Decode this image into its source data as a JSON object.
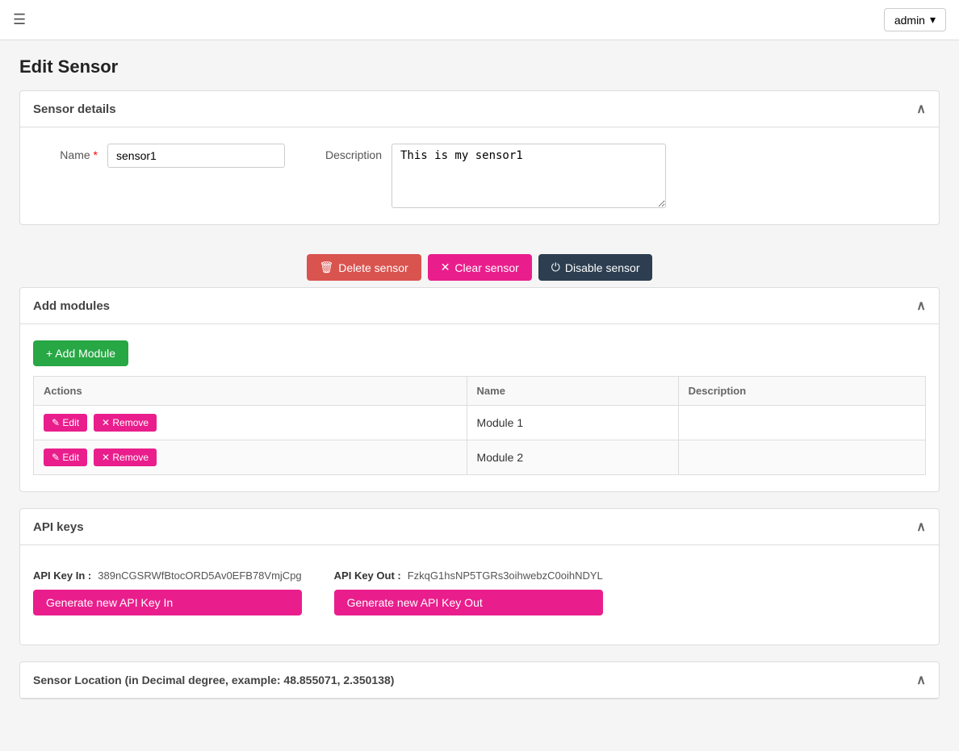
{
  "nav": {
    "hamburger": "☰",
    "admin_label": "admin",
    "admin_dropdown_arrow": "▾"
  },
  "page": {
    "title": "Edit Sensor"
  },
  "sensor_details": {
    "section_title": "Sensor details",
    "name_label": "Name",
    "name_required": "*",
    "name_value": "sensor1",
    "description_label": "Description",
    "description_value": "This is my sensor1"
  },
  "action_buttons": {
    "delete_label": "Delete sensor",
    "clear_label": "Clear sensor",
    "disable_label": "Disable sensor",
    "delete_icon": "🗑",
    "clear_icon": "✕",
    "disable_icon": "⏻"
  },
  "add_modules": {
    "section_title": "Add modules",
    "add_button_label": "+ Add Module",
    "table": {
      "headers": [
        "Actions",
        "Name",
        "Description"
      ],
      "rows": [
        {
          "name": "Module 1",
          "description": ""
        },
        {
          "name": "Module 2",
          "description": ""
        }
      ]
    },
    "edit_label": "Edit",
    "remove_label": "Remove",
    "edit_icon": "✎",
    "remove_icon": "✕"
  },
  "api_keys": {
    "section_title": "API keys",
    "api_key_in_label": "API Key In :",
    "api_key_in_value": "389nCGSRWfBtocORD5Av0EFB78VmjCpg",
    "generate_in_label": "Generate new API Key In",
    "api_key_out_label": "API Key Out :",
    "api_key_out_value": "FzkqG1hsNP5TGRs3oihwebzC0oihNDYL",
    "generate_out_label": "Generate new API Key Out"
  },
  "sensor_location": {
    "section_title": "Sensor Location (in Decimal degree, example: 48.855071, 2.350138)"
  }
}
